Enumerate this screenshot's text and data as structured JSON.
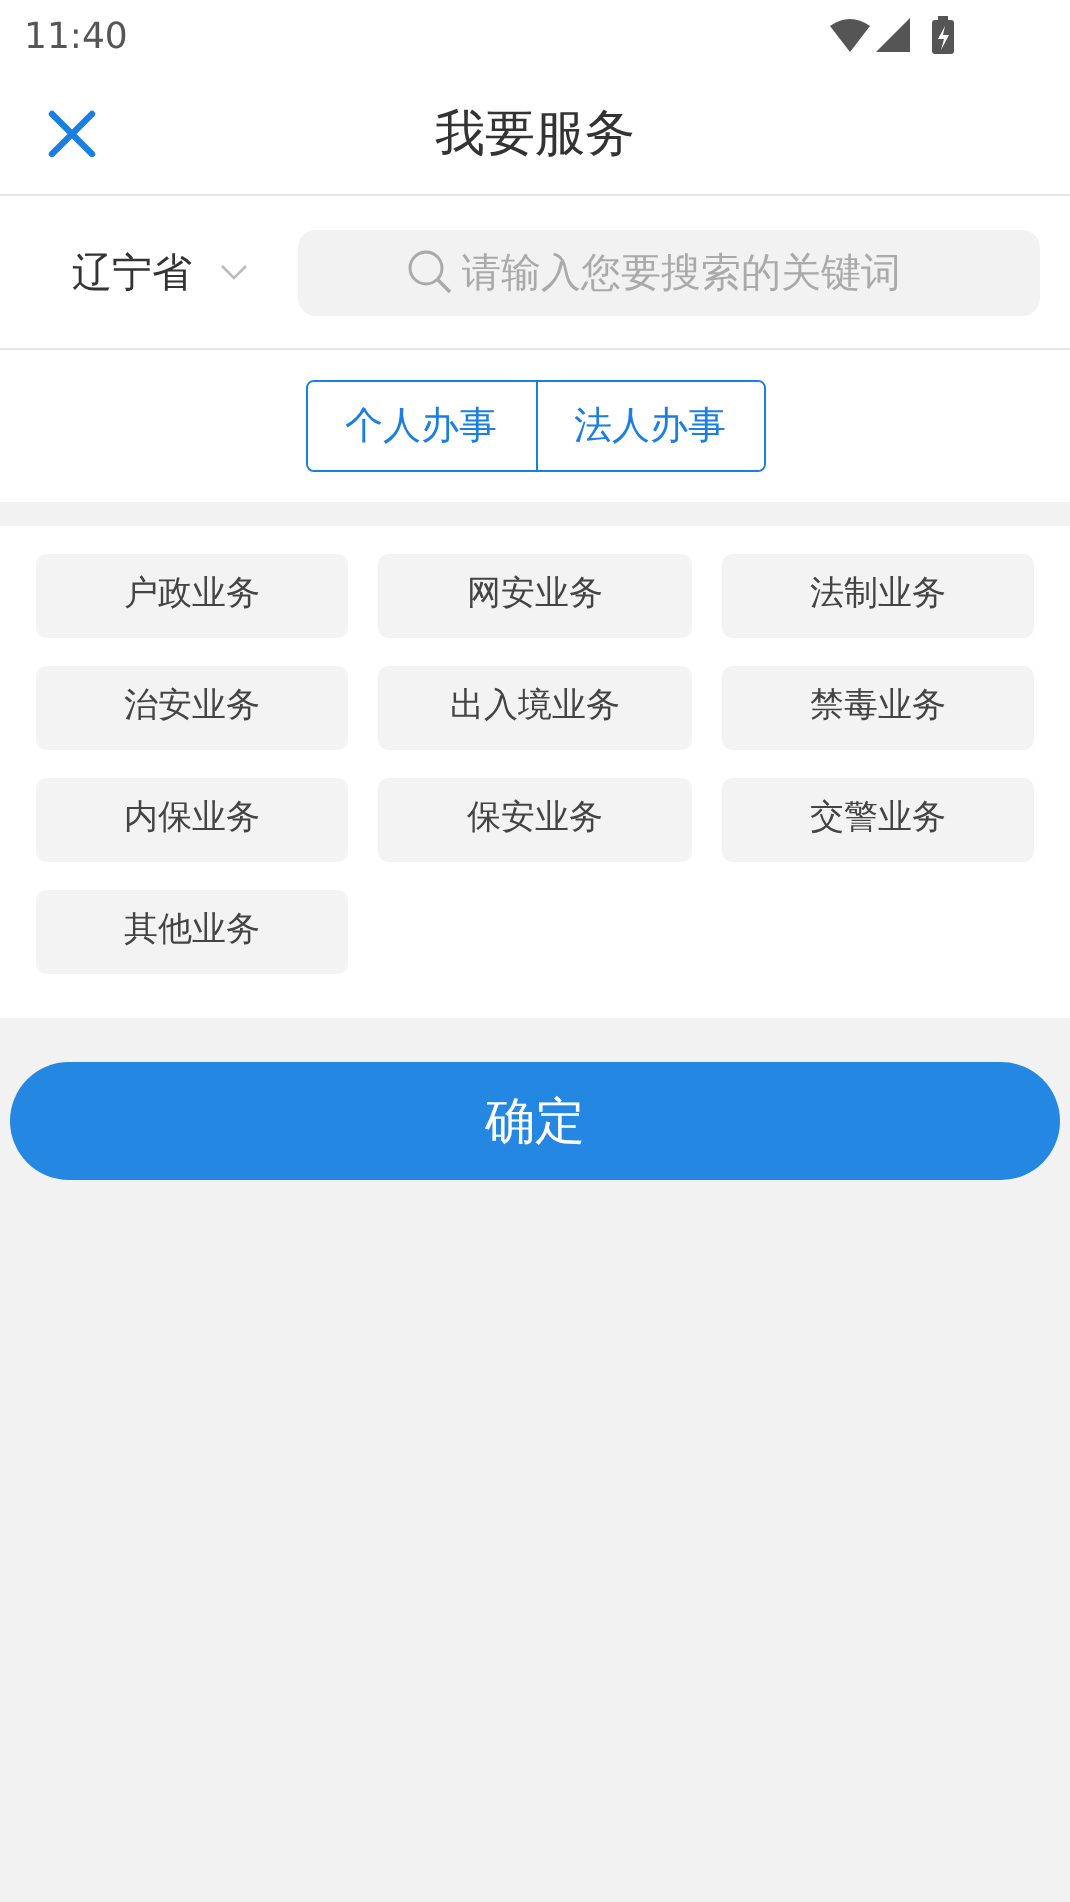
{
  "status_bar": {
    "time": "11:40"
  },
  "header": {
    "title": "我要服务"
  },
  "region": {
    "value": "辽宁省"
  },
  "search": {
    "placeholder": "请输入您要搜索的关键词"
  },
  "segments": [
    {
      "label": "个人办事"
    },
    {
      "label": "法人办事"
    }
  ],
  "categories": [
    "户政业务",
    "网安业务",
    "法制业务",
    "治安业务",
    "出入境业务",
    "禁毒业务",
    "内保业务",
    "保安业务",
    "交警业务",
    "其他业务"
  ],
  "confirm_button": "确定"
}
